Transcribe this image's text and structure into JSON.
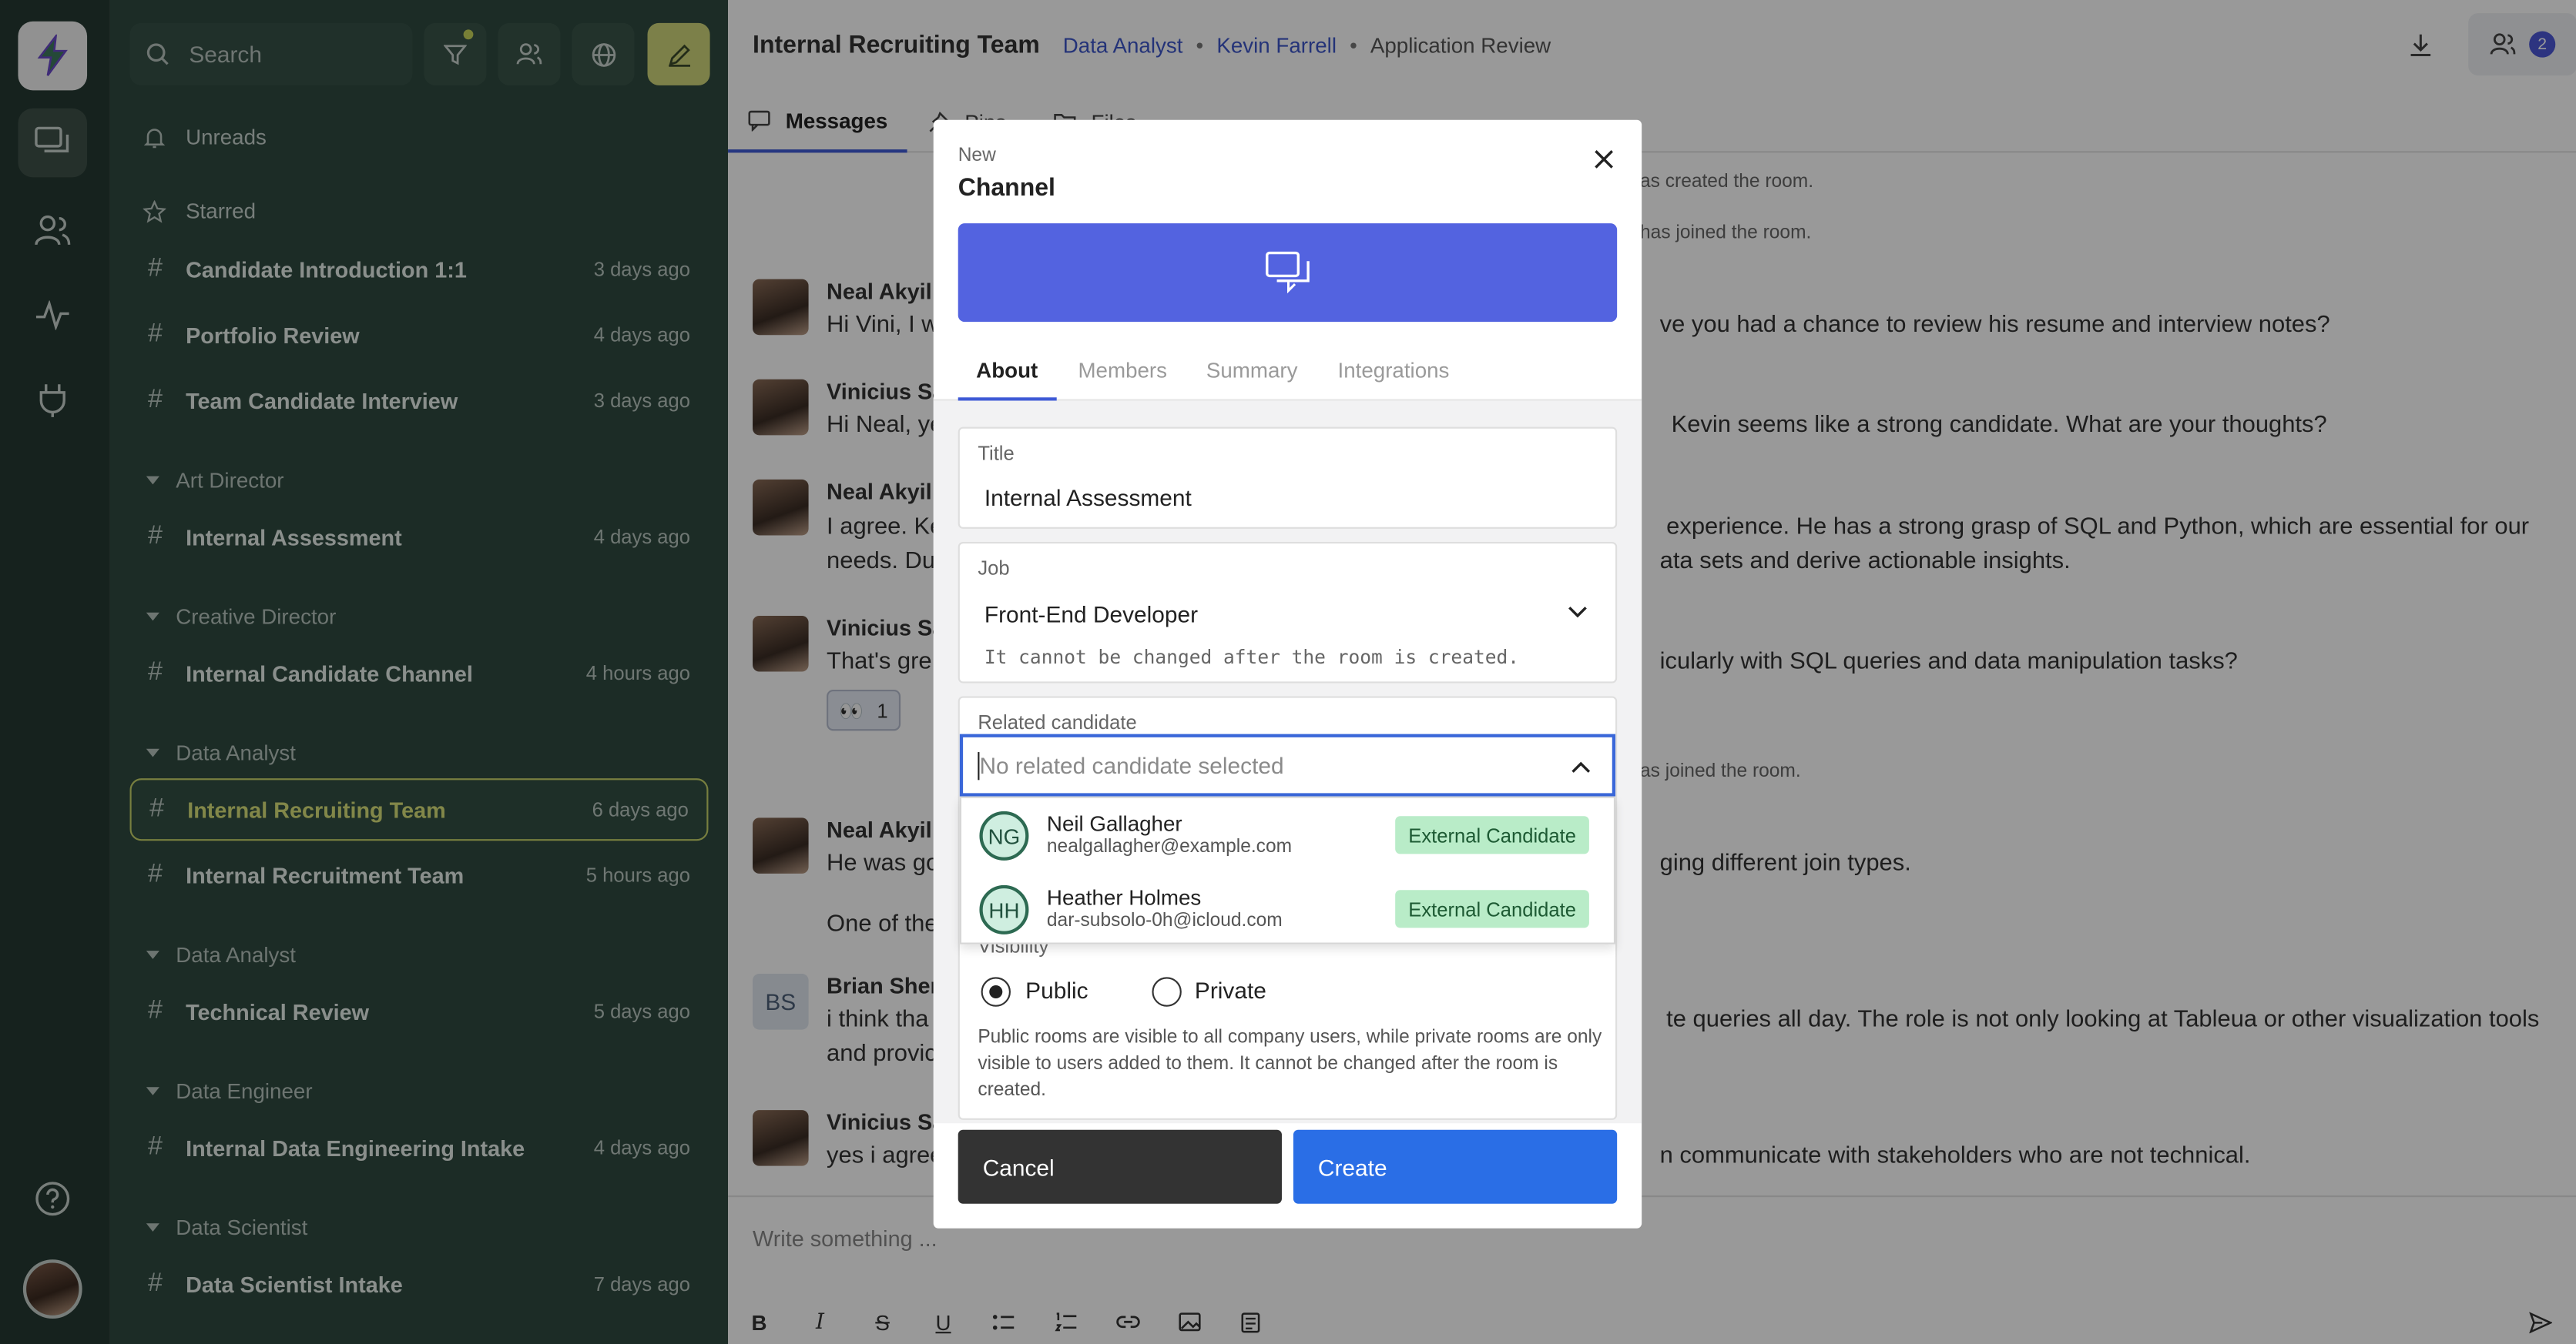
{
  "sidebar": {
    "search_placeholder": "Search",
    "unreads": "Unreads",
    "starred": "Starred",
    "starred_channels": [
      {
        "name": "Candidate Introduction 1:1",
        "time": "3 days ago"
      },
      {
        "name": "Portfolio Review",
        "time": "4 days ago"
      },
      {
        "name": "Team Candidate Interview",
        "time": "3 days ago"
      }
    ],
    "groups": [
      {
        "label": "Art Director",
        "channels": [
          {
            "name": "Internal Assessment",
            "time": "4 days ago"
          }
        ]
      },
      {
        "label": "Creative Director",
        "channels": [
          {
            "name": "Internal Candidate Channel",
            "time": "4 hours ago"
          }
        ]
      },
      {
        "label": "Data Analyst",
        "channels": [
          {
            "name": "Internal Recruiting Team",
            "time": "6 days ago"
          },
          {
            "name": "Internal Recruitment Team",
            "time": "5 hours ago"
          }
        ]
      },
      {
        "label": "Data Analyst",
        "channels": [
          {
            "name": "Technical Review",
            "time": "5 days ago"
          }
        ]
      },
      {
        "label": "Data Engineer",
        "channels": [
          {
            "name": "Internal Data Engineering Intake",
            "time": "4 days ago"
          }
        ]
      },
      {
        "label": "Data Scientist",
        "channels": [
          {
            "name": "Data Scientist Intake",
            "time": "7 days ago"
          }
        ]
      }
    ]
  },
  "header": {
    "room_title": "Internal Recruiting Team",
    "crumbs": [
      "Data Analyst",
      "Kevin Farrell",
      "Application Review"
    ],
    "member_count": "2"
  },
  "tabs": [
    "Messages",
    "Pins",
    "Files"
  ],
  "system_messages": [
    "as created the room.",
    "has joined the room.",
    "as joined the room."
  ],
  "messages": [
    {
      "author": "Neal Akyil",
      "lines": [
        "Hi Vini, I w",
        "ve you had a chance to review his resume and interview notes?"
      ]
    },
    {
      "author": "Vinicius Sa",
      "lines": [
        "Hi Neal, ye",
        "Kevin seems like a strong candidate. What are your thoughts?"
      ]
    },
    {
      "author": "Neal Akyil",
      "lines": [
        "I agree. Ke",
        "experience. He has a strong grasp of SQL and Python, which are essential for our",
        "needs. Du",
        "ata sets and derive actionable insights."
      ]
    },
    {
      "author": "Vinicius Sa",
      "lines": [
        "That's gre",
        "icularly with SQL queries and data manipulation tasks?"
      ],
      "reaction": {
        "emoji": "👀",
        "count": "1"
      }
    },
    {
      "author": "Neal Akyil",
      "lines": [
        "He was go",
        "ging different join types.",
        "One of the"
      ]
    },
    {
      "author": "Brian Sher",
      "initials": "BS",
      "lines": [
        "i think tha",
        "te queries all day. The role is not only looking at Tableua or other visualization tools",
        "and provic"
      ]
    },
    {
      "author": "Vinicius Sa",
      "lines": [
        "yes i agree",
        "n communicate with stakeholders who are not technical."
      ]
    }
  ],
  "composer": {
    "placeholder": "Write something ..."
  },
  "modal": {
    "kicker": "New",
    "title": "Channel",
    "tabs": [
      "About",
      "Members",
      "Summary",
      "Integrations"
    ],
    "title_label": "Title",
    "title_value": "Internal Assessment",
    "job_label": "Job",
    "job_value": "Front-End Developer",
    "job_hint": "It cannot be changed after the room is created.",
    "candidate_label": "Related candidate",
    "candidate_placeholder": "No related candidate selected",
    "candidates": [
      {
        "initials": "NG",
        "name": "Neil Gallagher",
        "email": "nealgallagher@example.com",
        "badge": "External Candidate"
      },
      {
        "initials": "HH",
        "name": "Heather Holmes",
        "email": "dar-subsolo-0h@icloud.com",
        "badge": "External Candidate"
      }
    ],
    "visibility_label": "Visibility",
    "public_label": "Public",
    "private_label": "Private",
    "visibility_desc": "Public rooms are visible to all company users, while private rooms are only visible to users added to them. It cannot be changed after the room is created.",
    "cancel": "Cancel",
    "create": "Create"
  },
  "colors": {
    "accent": "#3e5ad6",
    "banner": "#5363e0",
    "sidebar": "#2f4a40",
    "rail": "#263a33",
    "badge": "#b9ecc8"
  }
}
